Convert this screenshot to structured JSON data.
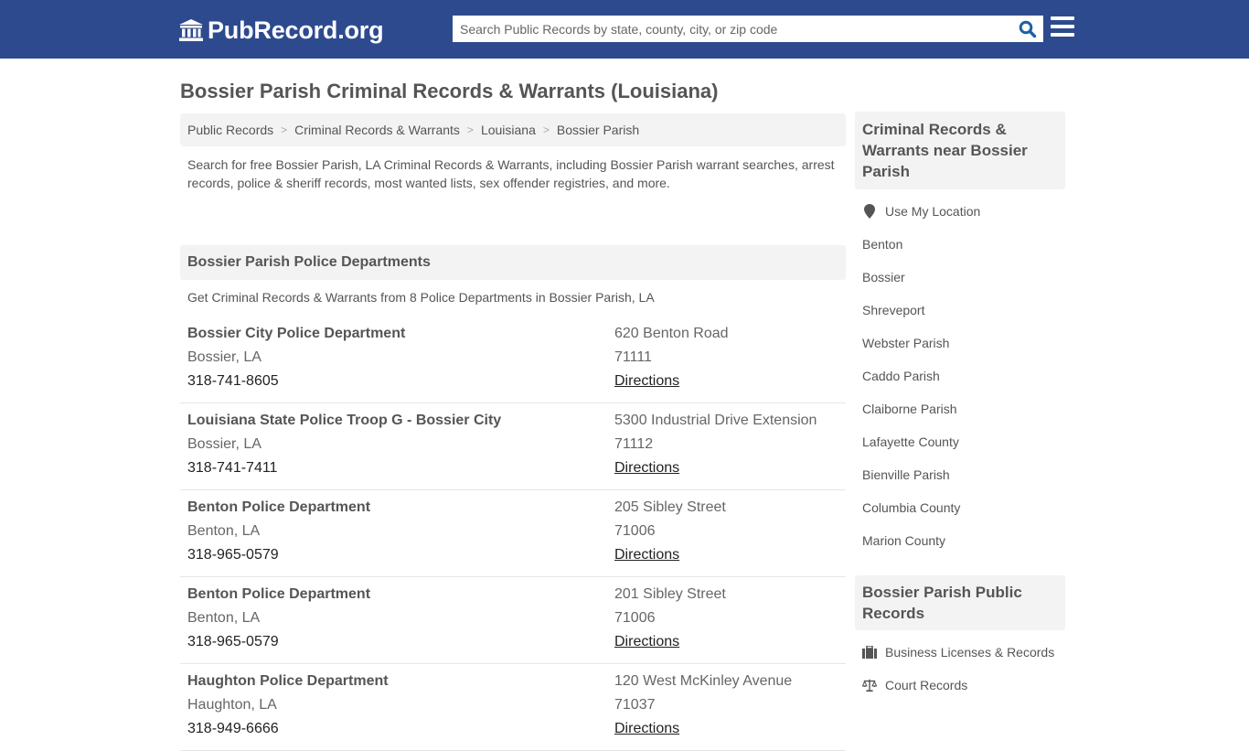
{
  "header": {
    "logo_text": "PubRecord.org",
    "search_placeholder": "Search Public Records by state, county, city, or zip code",
    "search_value": "",
    "colors": {
      "header_bg": "#2e4a8f",
      "search_icon": "#1d5fa8"
    }
  },
  "page": {
    "title": "Bossier Parish Criminal Records & Warrants (Louisiana)"
  },
  "breadcrumb": [
    {
      "label": "Public Records"
    },
    {
      "label": "Criminal Records & Warrants"
    },
    {
      "label": "Louisiana"
    },
    {
      "label": "Bossier Parish"
    }
  ],
  "intro": "Search for free Bossier Parish, LA Criminal Records & Warrants, including Bossier Parish warrant searches, arrest records, police & sheriff records, most wanted lists, sex offender registries, and more.",
  "departments": {
    "heading": "Bossier Parish Police Departments",
    "subheading": "Get Criminal Records & Warrants from 8 Police Departments in Bossier Parish, LA",
    "directions_label": "Directions",
    "items": [
      {
        "name": "Bossier City Police Department",
        "city": "Bossier, LA",
        "phone": "318-741-8605",
        "address": "620 Benton Road",
        "zip": "71111"
      },
      {
        "name": "Louisiana State Police Troop G - Bossier City",
        "city": "Bossier, LA",
        "phone": "318-741-7411",
        "address": "5300 Industrial Drive Extension",
        "zip": "71112"
      },
      {
        "name": "Benton Police Department",
        "city": "Benton, LA",
        "phone": "318-965-0579",
        "address": "205 Sibley Street",
        "zip": "71006"
      },
      {
        "name": "Benton Police Department",
        "city": "Benton, LA",
        "phone": "318-965-0579",
        "address": "201 Sibley Street",
        "zip": "71006"
      },
      {
        "name": "Haughton Police Department",
        "city": "Haughton, LA",
        "phone": "318-949-6666",
        "address": "120 West McKinley Avenue",
        "zip": "71037"
      }
    ]
  },
  "sidebar": {
    "nearby_heading": "Criminal Records & Warrants near Bossier Parish",
    "use_location": {
      "label": "Use My Location",
      "icon": "map-marker-icon"
    },
    "nearby": [
      "Benton",
      "Bossier",
      "Shreveport",
      "Webster Parish",
      "Caddo Parish",
      "Claiborne Parish",
      "Lafayette County",
      "Bienville Parish",
      "Columbia County",
      "Marion County"
    ],
    "records_heading": "Bossier Parish Public Records",
    "records": [
      {
        "label": "Business Licenses & Records",
        "icon": "briefcase-icon"
      },
      {
        "label": "Court Records",
        "icon": "scale-icon"
      }
    ]
  }
}
